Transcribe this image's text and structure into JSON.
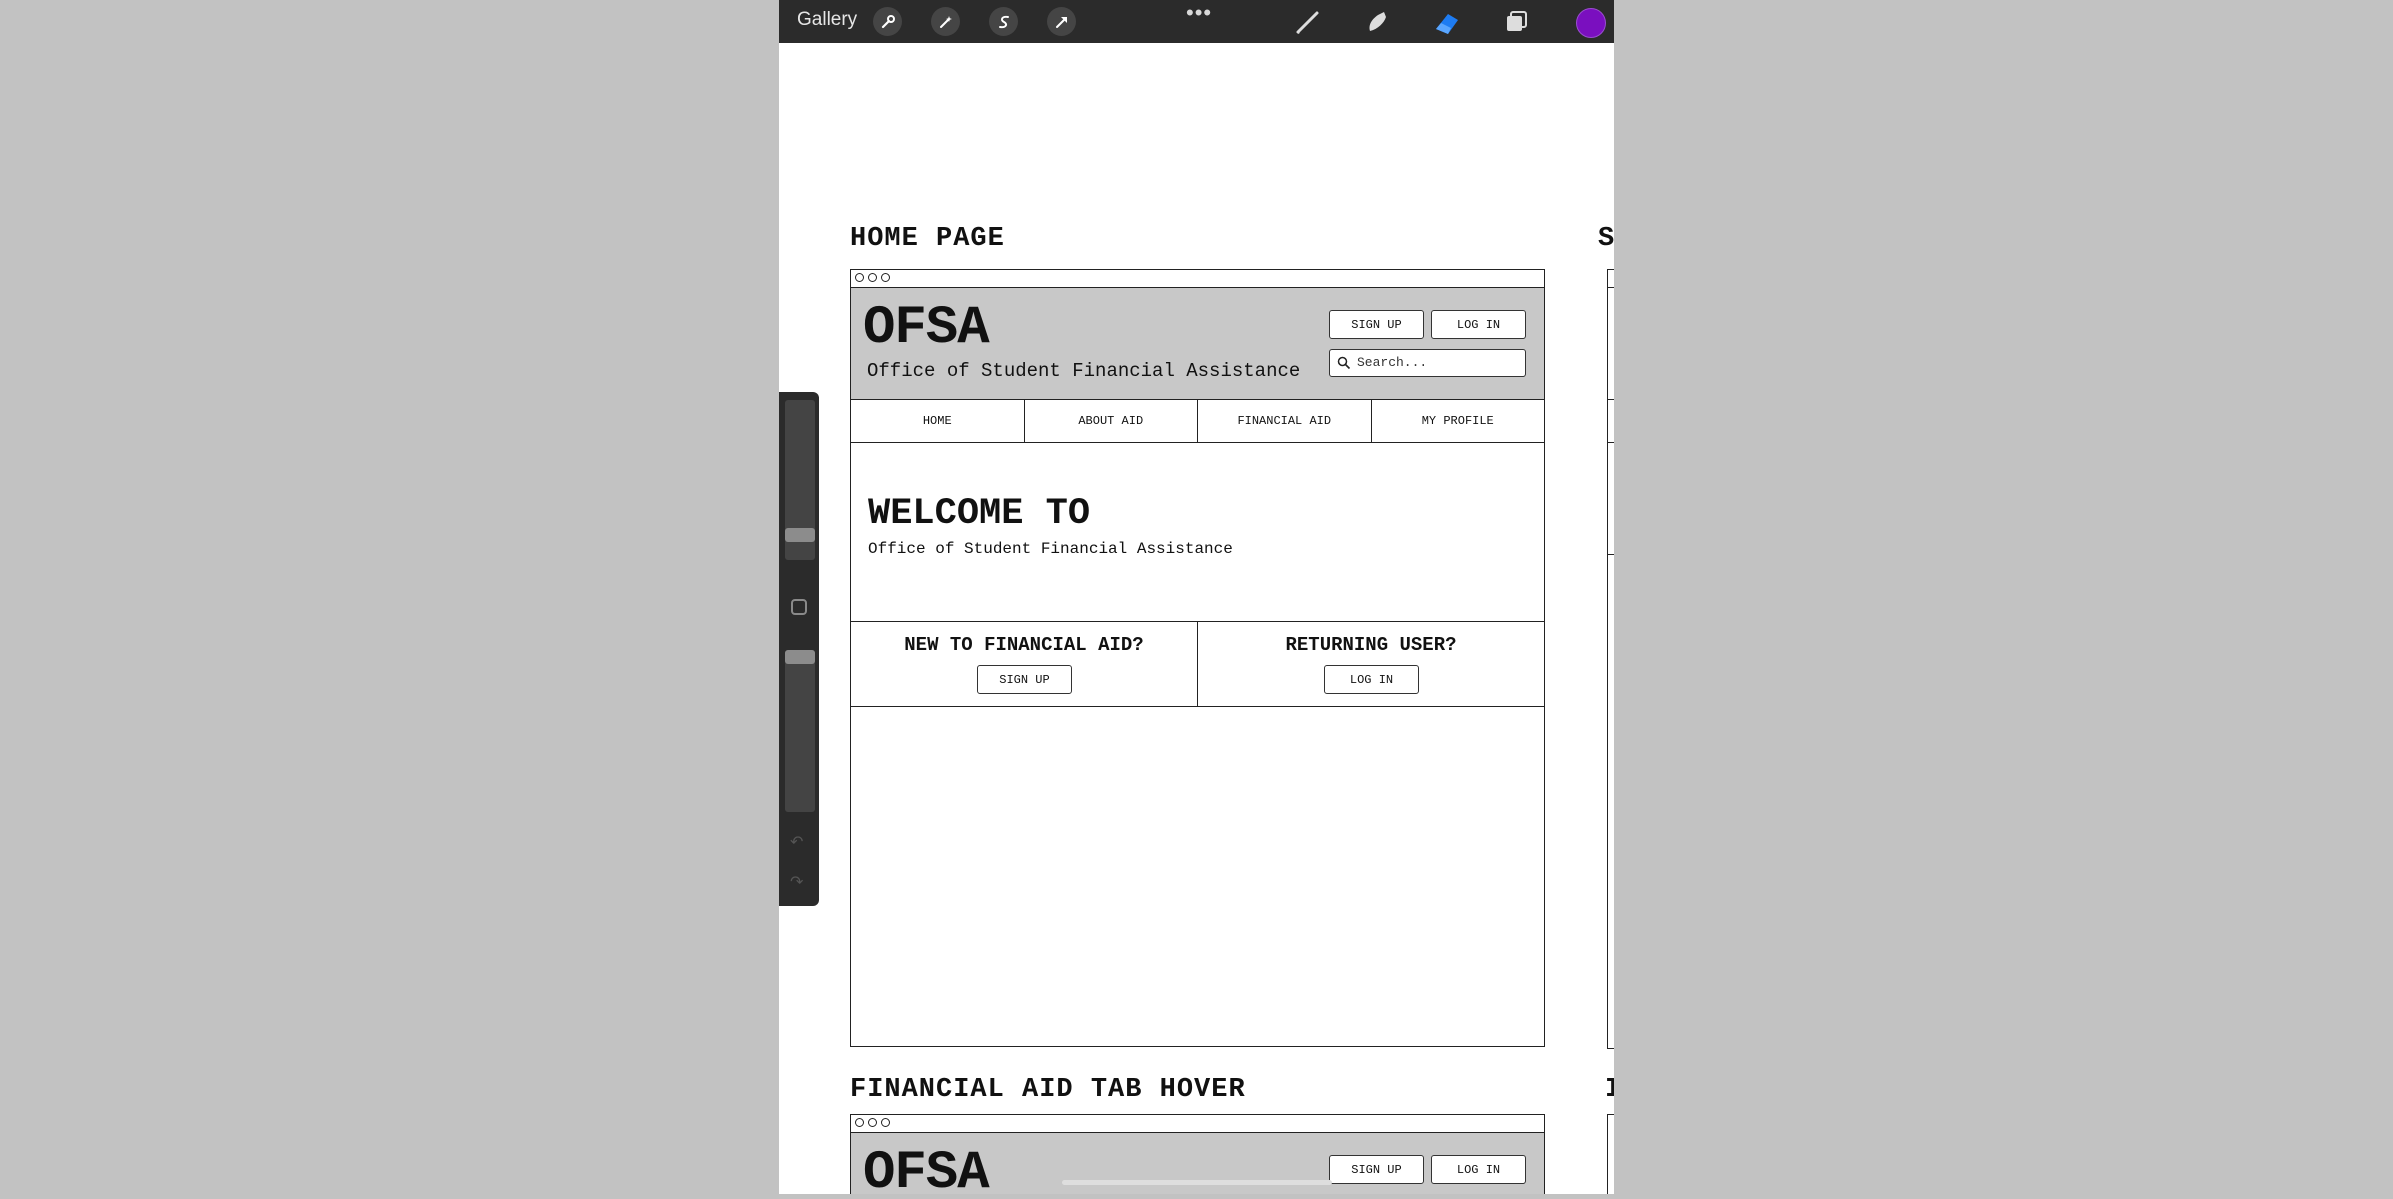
{
  "toolbar": {
    "gallery_label": "Gallery",
    "more_label": "•••",
    "active_color": "#7a0fbf",
    "tools": [
      "wrench-icon",
      "magic-wand-icon",
      "selection-icon",
      "transform-icon",
      "brush-icon",
      "smudge-icon",
      "eraser-icon",
      "layers-icon"
    ]
  },
  "canvas": {
    "home": {
      "section_title": "HOME PAGE",
      "logo": "OFSA",
      "tagline": "Office of Student Financial Assistance",
      "signup_label": "SIGN UP",
      "login_label": "LOG IN",
      "search_placeholder": "Search...",
      "nav": [
        "HOME",
        "ABOUT AID",
        "FINANCIAL AID",
        "MY PROFILE"
      ],
      "welcome_title": "WELCOME TO",
      "welcome_sub": "Office of Student Financial Assistance",
      "new_user_title": "NEW TO FINANCIAL AID?",
      "new_user_button": "SIGN UP",
      "returning_title": "RETURNING USER?",
      "returning_button": "LOG IN"
    },
    "hover": {
      "section_title": "FINANCIAL AID TAB HOVER",
      "logo": "OFSA",
      "signup_label": "SIGN UP",
      "login_label": "LOG IN"
    },
    "peek_right_top": "S",
    "peek_right_bottom": "I"
  }
}
